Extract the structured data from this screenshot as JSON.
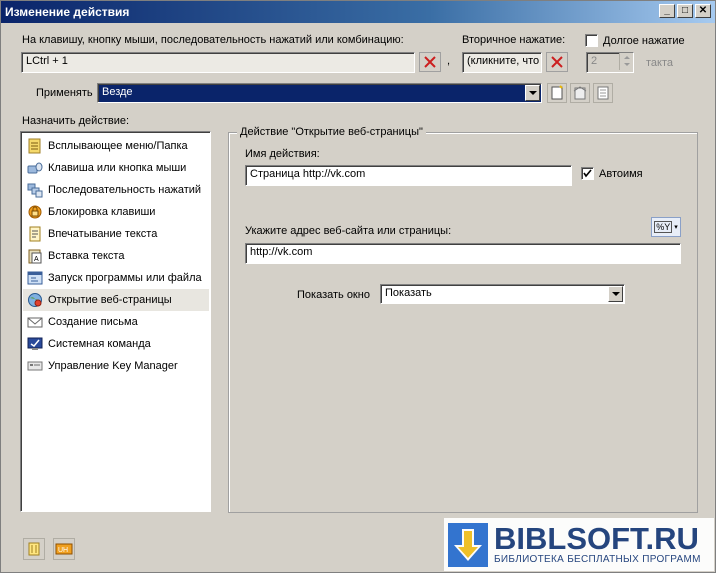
{
  "window": {
    "title": "Изменение действия",
    "controls": [
      "_",
      "□",
      "✕"
    ]
  },
  "hotkey": {
    "label": "На клавишу, кнопку мыши, последовательность нажатий или комбинацию:",
    "value": "LCtrl + 1",
    "comma": ",",
    "secondary_label": "Вторичное нажатие:",
    "secondary_value": "(кликните, что",
    "long_press_label": "Долгое нажатие",
    "long_press_checked": false,
    "taps_value": "2",
    "taps_label": "такта"
  },
  "apply": {
    "label": "Применять",
    "value": "Везде"
  },
  "assign": {
    "label": "Назначить действие:",
    "items": [
      {
        "label": "Всплывающее меню/Папка",
        "icon": "popup-menu-icon"
      },
      {
        "label": "Клавиша или кнопка мыши",
        "icon": "key-mouse-icon"
      },
      {
        "label": "Последовательность нажатий",
        "icon": "key-sequence-icon"
      },
      {
        "label": "Блокировка клавиши",
        "icon": "lock-icon"
      },
      {
        "label": "Впечатывание текста",
        "icon": "type-text-icon"
      },
      {
        "label": "Вставка текста",
        "icon": "paste-text-icon"
      },
      {
        "label": "Запуск программы или файла",
        "icon": "run-program-icon"
      },
      {
        "label": "Открытие веб-страницы",
        "icon": "globe-icon"
      },
      {
        "label": "Создание письма",
        "icon": "mail-icon"
      },
      {
        "label": "Системная команда",
        "icon": "system-command-icon"
      },
      {
        "label": "Управление Key Manager",
        "icon": "key-manager-icon"
      }
    ],
    "selected_index": 7
  },
  "action": {
    "group_title": "Действие \"Открытие веб-страницы\"",
    "name_label": "Имя действия:",
    "name_value": "Страница http://vk.com",
    "autoname_label": "Автоимя",
    "autoname_checked": true,
    "url_label": "Укажите адрес веб-сайта или страницы:",
    "url_value": "http://vk.com",
    "vars_button": "%Y",
    "show_window_label": "Показать окно",
    "show_window_value": "Показать"
  },
  "watermark": {
    "title": "BIBLSOFT.RU",
    "subtitle": "БИБЛИОТЕКА БЕСПЛАТНЫХ ПРОГРАММ"
  },
  "colors": {
    "title_start": "#0a246a",
    "title_end": "#a6caf0",
    "dialog_bg": "#d4d0c8",
    "apply_field_bg": "#0a246a",
    "watermark_text": "#1b3d7a"
  }
}
